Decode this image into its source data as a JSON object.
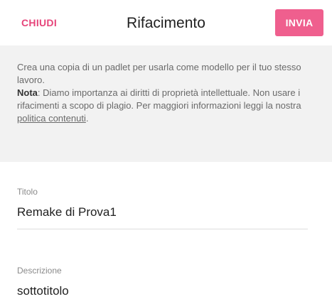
{
  "header": {
    "close_label": "CHIUDI",
    "title": "Rifacimento",
    "send_label": "INVIA"
  },
  "notice": {
    "intro": "Crea una copia di un padlet per usarla come modello per il tuo stesso lavoro.",
    "note_label": "Nota",
    "note_text": ": Diamo importanza ai diritti di proprietà intellettuale. Non usare i rifacimenti a scopo di plagio. Per maggiori informazioni leggi la nostra ",
    "link_text": "politica contenuti",
    "end": "."
  },
  "form": {
    "title_label": "Titolo",
    "title_value": "Remake di Prova1",
    "description_label": "Descrizione",
    "description_value": "sottotitolo"
  },
  "colors": {
    "accent": "#ef5f8e",
    "accent_text": "#e6457a",
    "notice_background": "#f2f2f2"
  }
}
